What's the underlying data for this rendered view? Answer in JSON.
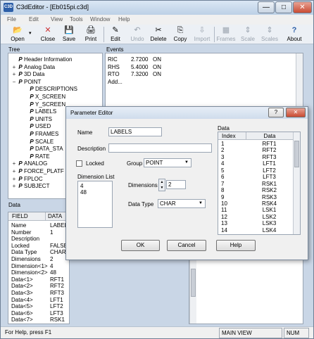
{
  "window": {
    "title": "C3dEditor - [Eb015pi.c3d]",
    "icon": "C3D",
    "controls": [
      "—",
      "□",
      "✕"
    ]
  },
  "menu": [
    "File",
    "Edit",
    "View",
    "Tools",
    "Window",
    "Help"
  ],
  "toolbar": [
    {
      "label": "Open",
      "icon": "📂",
      "enabled": true
    },
    {
      "label": "Close",
      "icon": "✕",
      "enabled": true
    },
    {
      "label": "Save",
      "icon": "💾",
      "enabled": true
    },
    {
      "label": "Print",
      "icon": "🖨",
      "enabled": true
    },
    {
      "label": "Edit",
      "icon": "✎",
      "enabled": true
    },
    {
      "label": "Undo",
      "icon": "↶",
      "enabled": false
    },
    {
      "label": "Delete",
      "icon": "✂",
      "enabled": true
    },
    {
      "label": "Copy",
      "icon": "⎘",
      "enabled": true
    },
    {
      "label": "Import",
      "icon": "⇩",
      "enabled": false
    },
    {
      "label": "Frames",
      "icon": "▦",
      "enabled": false
    },
    {
      "label": "Scale",
      "icon": "⇕",
      "enabled": false
    },
    {
      "label": "Scales",
      "icon": "⇕",
      "enabled": false
    },
    {
      "label": "About",
      "icon": "?",
      "enabled": true
    }
  ],
  "tree": {
    "label": "Tree",
    "items": [
      {
        "text": "Header Information",
        "level": 0,
        "exp": ""
      },
      {
        "text": "Analog Data",
        "level": 0,
        "exp": "+"
      },
      {
        "text": "3D Data",
        "level": 0,
        "exp": "+"
      },
      {
        "text": "POINT",
        "level": 0,
        "exp": "−"
      },
      {
        "text": "DESCRIPTIONS",
        "level": 1,
        "exp": ""
      },
      {
        "text": "X_SCREEN",
        "level": 1,
        "exp": ""
      },
      {
        "text": "Y_SCREEN",
        "level": 1,
        "exp": ""
      },
      {
        "text": "LABELS",
        "level": 1,
        "exp": ""
      },
      {
        "text": "UNITS",
        "level": 1,
        "exp": ""
      },
      {
        "text": "USED",
        "level": 1,
        "exp": ""
      },
      {
        "text": "FRAMES",
        "level": 1,
        "exp": ""
      },
      {
        "text": "SCALE",
        "level": 1,
        "exp": ""
      },
      {
        "text": "DATA_STA",
        "level": 1,
        "exp": ""
      },
      {
        "text": "RATE",
        "level": 1,
        "exp": ""
      },
      {
        "text": "ANALOG",
        "level": 0,
        "exp": "+"
      },
      {
        "text": "FORCE_PLATF",
        "level": 0,
        "exp": "+"
      },
      {
        "text": "FPLOC",
        "level": 0,
        "exp": "+"
      },
      {
        "text": "SUBJECT",
        "level": 0,
        "exp": "+"
      }
    ]
  },
  "events": {
    "label": "Events",
    "rows": [
      {
        "name": "RIC",
        "time": "2.7200",
        "state": "ON"
      },
      {
        "name": "RHS",
        "time": "5.4000",
        "state": "ON"
      },
      {
        "name": "RTO",
        "time": "7.3200",
        "state": "ON"
      },
      {
        "name": "Add...",
        "time": "",
        "state": ""
      }
    ]
  },
  "data_panel": {
    "label": "Data",
    "headers": [
      "FIELD",
      "DATA"
    ],
    "rows": [
      [
        "Name",
        "LABELS"
      ],
      [
        "Number",
        "1"
      ],
      [
        "Description",
        ""
      ],
      [
        "Locked",
        "FALSE"
      ],
      [
        "Data Type",
        "CHAR"
      ],
      [
        "Dimensions",
        "2"
      ],
      [
        "Dimension<1>",
        "4"
      ],
      [
        "Dimension<2>",
        "48"
      ],
      [
        "Data<1>",
        "RFT1"
      ],
      [
        "Data<2>",
        "RFT2"
      ],
      [
        "Data<3>",
        "RFT3"
      ],
      [
        "Data<4>",
        "LFT1"
      ],
      [
        "Data<5>",
        "LFT2"
      ],
      [
        "Data<6>",
        "LFT3"
      ],
      [
        "Data<7>",
        "RSK1"
      ]
    ]
  },
  "dialog": {
    "title": "Parameter Editor",
    "help_glyph": "?",
    "close_glyph": "✕",
    "name_label": "Name",
    "name_value": "LABELS",
    "desc_label": "Description",
    "desc_value": "",
    "locked_label": "Locked",
    "locked": false,
    "group_label": "Group",
    "group_value": "POINT",
    "dim_list_label": "Dimension List",
    "dim_list": [
      "4",
      "48"
    ],
    "dimensions_label": "Dimensions",
    "dimensions_value": "2",
    "dtype_label": "Data Type",
    "dtype_value": "CHAR",
    "data_label": "Data",
    "table_headers": [
      "Index",
      "Data"
    ],
    "table_rows": [
      [
        "1",
        "RFT1"
      ],
      [
        "2",
        "RFT2"
      ],
      [
        "3",
        "RFT3"
      ],
      [
        "4",
        "LFT1"
      ],
      [
        "5",
        "LFT2"
      ],
      [
        "6",
        "LFT3"
      ],
      [
        "7",
        "RSK1"
      ],
      [
        "8",
        "RSK2"
      ],
      [
        "9",
        "RSK3"
      ],
      [
        "10",
        "RSK4"
      ],
      [
        "11",
        "LSK1"
      ],
      [
        "12",
        "LSK2"
      ],
      [
        "13",
        "LSK3"
      ],
      [
        "14",
        "LSK4"
      ]
    ],
    "ok": "OK",
    "cancel": "Cancel",
    "help": "Help"
  },
  "status": {
    "help_text": "For Help, press F1",
    "view": "MAIN VIEW",
    "num": "NUM"
  }
}
